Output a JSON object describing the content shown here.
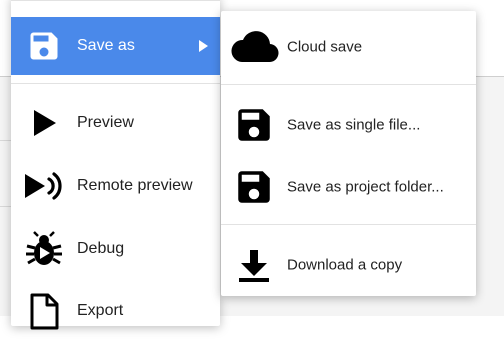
{
  "main_menu": {
    "save_as": {
      "label": "Save as",
      "icon": "floppy-disk-icon"
    },
    "preview": {
      "label": "Preview",
      "icon": "play-icon"
    },
    "remote_preview": {
      "label": "Remote preview",
      "icon": "remote-play-icon"
    },
    "debug": {
      "label": "Debug",
      "icon": "bug-icon"
    },
    "export": {
      "label": "Export",
      "icon": "document-icon"
    }
  },
  "submenu": {
    "cloud_save": {
      "label": "Cloud save",
      "icon": "cloud-icon"
    },
    "single_file": {
      "label": "Save as single file...",
      "icon": "floppy-disk-icon"
    },
    "project_folder": {
      "label": "Save as project folder...",
      "icon": "floppy-disk-icon"
    },
    "download_copy": {
      "label": "Download a copy",
      "icon": "download-icon"
    }
  },
  "colors": {
    "active_highlight": "#4a89ea",
    "icon": "#000000"
  }
}
